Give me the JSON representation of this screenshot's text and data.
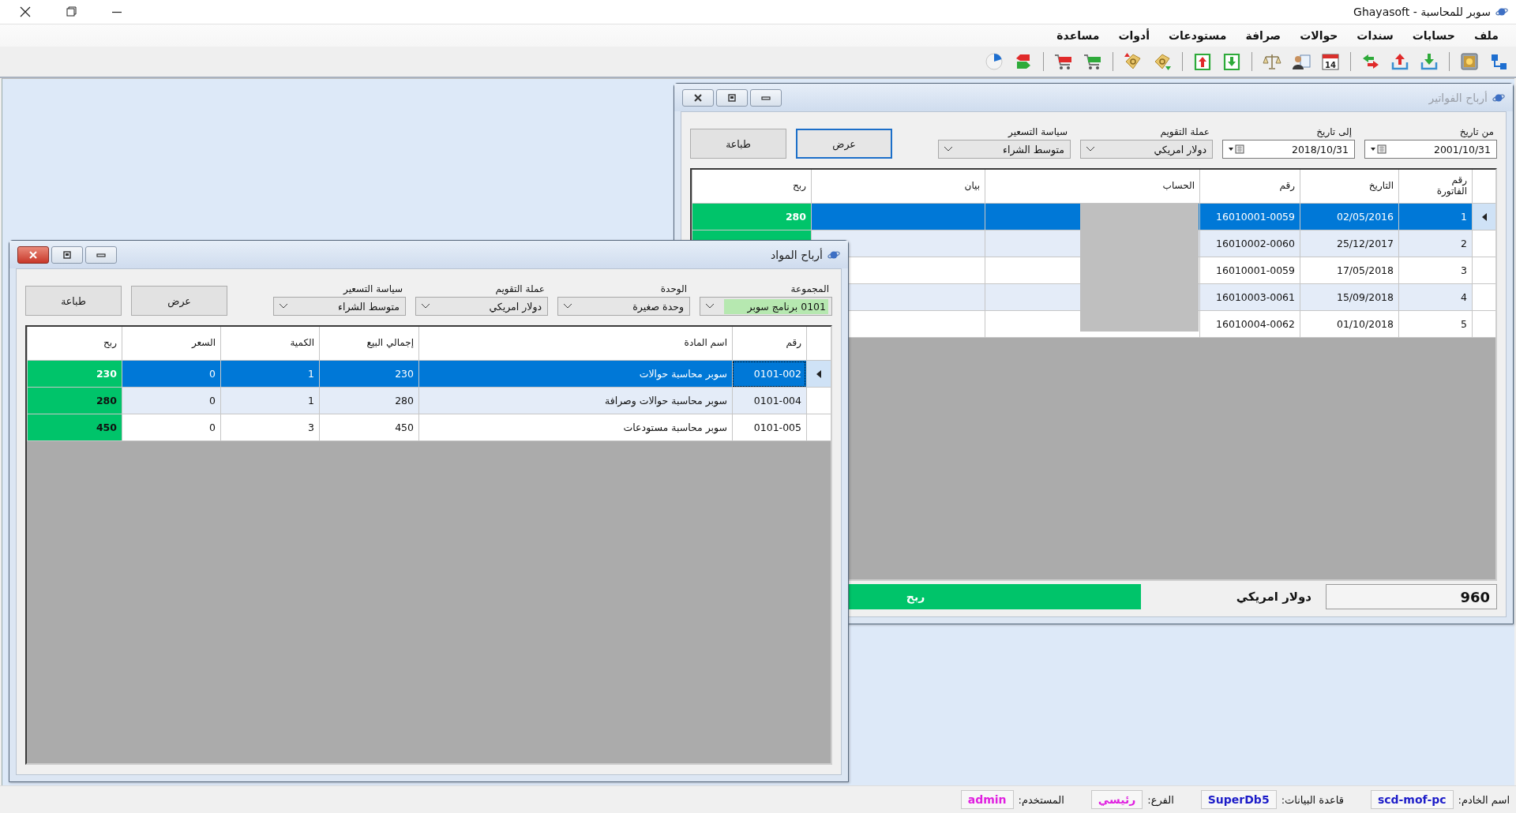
{
  "window": {
    "title": "سوبر للمحاسبة - Ghayasoft"
  },
  "menu": [
    "ملف",
    "حسابات",
    "سندات",
    "حوالات",
    "صرافة",
    "مستودعات",
    "أدوات",
    "مساعدة"
  ],
  "toolbar": [
    {
      "kind": "tree"
    },
    {
      "kind": "safe"
    },
    {
      "kind": "separator"
    },
    {
      "kind": "tray-in"
    },
    {
      "kind": "tray-out"
    },
    {
      "kind": "exchange"
    },
    {
      "kind": "separator"
    },
    {
      "kind": "calendar",
      "text": "14"
    },
    {
      "kind": "contact"
    },
    {
      "kind": "scales"
    },
    {
      "kind": "separator"
    },
    {
      "kind": "box-in"
    },
    {
      "kind": "box-out"
    },
    {
      "kind": "separator"
    },
    {
      "kind": "tag-in"
    },
    {
      "kind": "tag-out"
    },
    {
      "kind": "separator"
    },
    {
      "kind": "cart-in"
    },
    {
      "kind": "cart-out"
    },
    {
      "kind": "separator"
    },
    {
      "kind": "transfer"
    },
    {
      "kind": "pie"
    }
  ],
  "invoice_window": {
    "title": "أرباح الفواتير",
    "active": false,
    "filters": [
      {
        "label": "من تاريخ",
        "value": "2001/10/31",
        "kind": "date"
      },
      {
        "label": "إلى تاريخ",
        "value": "2018/10/31",
        "kind": "date"
      },
      {
        "label": "عملة التقويم",
        "value": "دولار امريكي",
        "kind": "combo"
      },
      {
        "label": "سياسة التسعير",
        "value": "متوسط الشراء",
        "kind": "combo"
      }
    ],
    "buttons": [
      {
        "label": "عرض",
        "focused": true
      },
      {
        "label": "طباعة",
        "focused": false
      }
    ],
    "table": {
      "columns": [
        "رقم\nالفاتورة",
        "التاريخ",
        "رقم",
        "الحساب",
        "بيان",
        "ربح"
      ],
      "rows": [
        {
          "cells": [
            "1",
            "02/05/2016",
            "16010001-0059"
          ],
          "profit": "280",
          "selected": true
        },
        {
          "cells": [
            "2",
            "25/12/2017",
            "16010002-0060"
          ],
          "selected": false,
          "profit_fill": true
        },
        {
          "cells": [
            "3",
            "17/05/2018",
            "16010001-0059"
          ],
          "selected": false
        },
        {
          "cells": [
            "4",
            "15/09/2018",
            "16010003-0061"
          ],
          "selected": false
        },
        {
          "cells": [
            "5",
            "01/10/2018",
            "16010004-0062"
          ],
          "selected": false
        }
      ]
    },
    "total": "960",
    "currency": "دولار امريكي",
    "profit_label": "ربح"
  },
  "materials_window": {
    "title": "أرباح المواد",
    "active": true,
    "filters": [
      {
        "label": "المجموعة",
        "value": "0101 برنامج سوبر",
        "kind": "combo",
        "highlighted": true
      },
      {
        "label": "الوحدة",
        "value": "وحدة صغيرة",
        "kind": "combo",
        "highlighted": false
      },
      {
        "label": "عملة التقويم",
        "value": "دولار امريكي",
        "kind": "combo",
        "highlighted": false
      },
      {
        "label": "سياسة التسعير",
        "value": "متوسط الشراء",
        "kind": "combo",
        "highlighted": false
      }
    ],
    "buttons": [
      {
        "label": "عرض",
        "focused": false
      },
      {
        "label": "طباعة",
        "focused": false
      }
    ],
    "table": {
      "columns": [
        "رقم",
        "اسم المادة",
        "إجمالي البيع",
        "الكمية",
        "السعر",
        "ربح"
      ],
      "rows": [
        {
          "cells": [
            "0101-002",
            "سوبر محاسبة حوالات",
            "230",
            "1",
            "0"
          ],
          "profit": "230",
          "selected": true,
          "focused": true
        },
        {
          "cells": [
            "0101-004",
            "سوبر محاسبة حوالات وصرافة",
            "280",
            "1",
            "0"
          ],
          "profit": "280",
          "selected": false,
          "focused": false
        },
        {
          "cells": [
            "0101-005",
            "سوبر محاسبة مستودعات",
            "450",
            "3",
            "0"
          ],
          "profit": "450",
          "selected": false,
          "focused": false
        }
      ]
    }
  },
  "status_bar": [
    {
      "label": "اسم الخادم:",
      "value": "scd-mof-pc",
      "color": "#1c1cc8"
    },
    {
      "label": "قاعدة البيانات:",
      "value": "SuperDb5",
      "color": "#1c1cc8"
    },
    {
      "label": "الفرع:",
      "value": "رئيسي",
      "color": "#e020e0"
    },
    {
      "label": "المستخدم:",
      "value": "admin",
      "color": "#e020e0"
    }
  ]
}
